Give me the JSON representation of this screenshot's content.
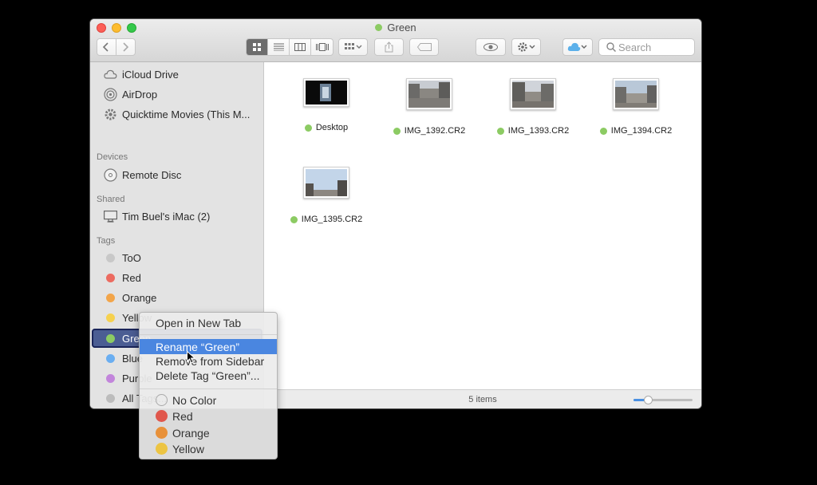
{
  "window": {
    "title": "Green",
    "title_tag_color": "#8ccb63"
  },
  "toolbar": {
    "search_placeholder": "Search",
    "view_buttons": [
      "icon-view",
      "list-view",
      "column-view",
      "cover-flow-view"
    ],
    "icons": [
      "back-icon",
      "forward-icon",
      "arrange-icon",
      "share-icon",
      "tag-icon",
      "quick-look-icon",
      "action-gear-icon",
      "icloud-icon",
      "search-icon"
    ]
  },
  "sidebar": {
    "favorites": [
      {
        "label": "iCloud Drive",
        "icon": "cloud-icon"
      },
      {
        "label": "AirDrop",
        "icon": "airdrop-icon"
      },
      {
        "label": "Quicktime Movies (This M...",
        "icon": "gear-icon"
      }
    ],
    "devices_header": "Devices",
    "devices": [
      {
        "label": "Remote Disc",
        "icon": "disc-icon"
      }
    ],
    "shared_header": "Shared",
    "shared": [
      {
        "label": "Tim Buel's iMac (2)",
        "icon": "imac-icon"
      }
    ],
    "tags_header": "Tags",
    "tags": [
      {
        "label": "ToO",
        "color": "#c8c8c8"
      },
      {
        "label": "Red",
        "color": "#ec6b60"
      },
      {
        "label": "Orange",
        "color": "#f2a54a"
      },
      {
        "label": "Yellow",
        "color": "#f6d14f"
      },
      {
        "label": "Green",
        "color": "#8ccb63"
      },
      {
        "label": "Blue",
        "color": "#6aaef1"
      },
      {
        "label": "Purple",
        "color": "#c285db"
      },
      {
        "label": "All Tags...",
        "color": "#bcbcbc"
      }
    ]
  },
  "files": [
    {
      "name": "Desktop",
      "tag_color": "#8ccb63"
    },
    {
      "name": "IMG_1392.CR2",
      "tag_color": "#8ccb63"
    },
    {
      "name": "IMG_1393.CR2",
      "tag_color": "#8ccb63"
    },
    {
      "name": "IMG_1394.CR2",
      "tag_color": "#8ccb63"
    },
    {
      "name": "IMG_1395.CR2",
      "tag_color": "#8ccb63"
    }
  ],
  "status": {
    "item_count": "5 items",
    "icon_size_fraction": 0.25
  },
  "context_menu": {
    "items": [
      "Open in New Tab",
      "Rename “Green”",
      "Remove from Sidebar",
      "Delete Tag “Green”..."
    ],
    "highlighted_index": 1,
    "colors": [
      {
        "label": "No Color",
        "color": "none"
      },
      {
        "label": "Red",
        "color": "#e0574c"
      },
      {
        "label": "Orange",
        "color": "#e8913a"
      },
      {
        "label": "Yellow",
        "color": "#ecc443"
      }
    ]
  }
}
